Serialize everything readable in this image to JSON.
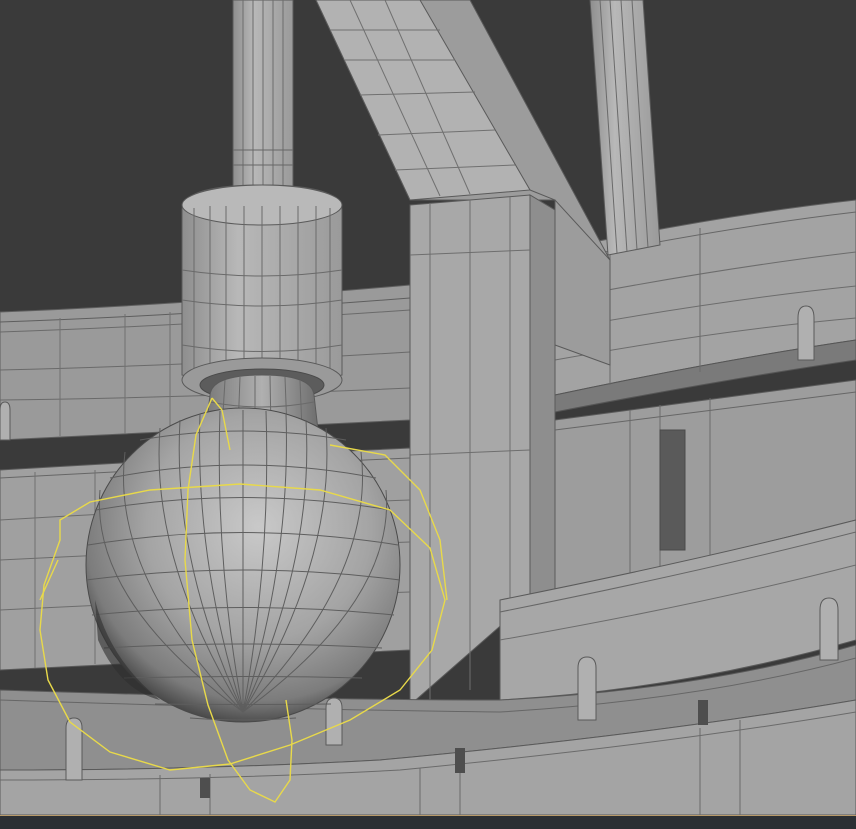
{
  "viewport": {
    "view": "perspective",
    "shading": "shaded-with-wireframe",
    "background_color": "#3a3a3a",
    "mesh_color": "#a6a6a6",
    "wire_color": "#5a5a5a",
    "selection_color": "#e8d94a",
    "bottom_bar_color": "#2b2f33",
    "bottom_bar_accent": "#b89a6a"
  },
  "scene": {
    "selected_object": "light-bulb-sphere",
    "objects": [
      "ceiling-rod-left",
      "ceiling-rod-right",
      "diagonal-beam",
      "vertical-beam",
      "socket-cap",
      "socket-neck",
      "light-bulb-sphere",
      "curved-ring-rails",
      "hook-pins",
      "light-helper-gizmo"
    ]
  }
}
